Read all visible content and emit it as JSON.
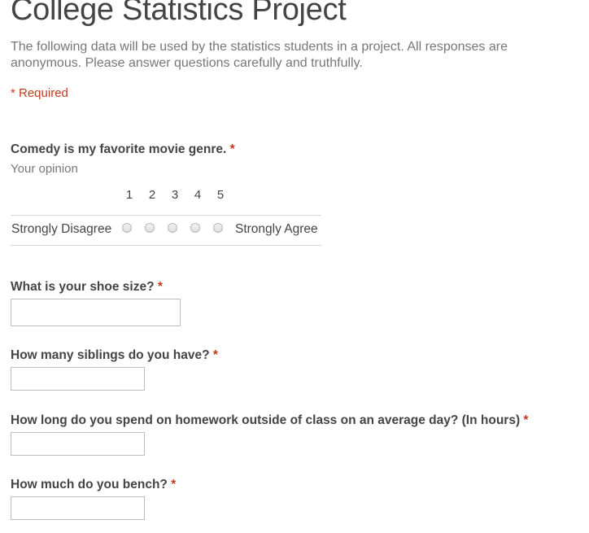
{
  "form": {
    "title": "College Statistics Project",
    "description": "The following data will be used by the statistics students in a project. All responses are anonymous. Please answer questions carefully and truthfully.",
    "required_note": "* Required",
    "required_marker": "*",
    "accent_color": "#c43b1d"
  },
  "questions": [
    {
      "type": "scale",
      "title": "Comedy is my favorite movie genre.",
      "help_text": "Your opinion",
      "scale_numbers": [
        "1",
        "2",
        "3",
        "4",
        "5"
      ],
      "low_label": "Strongly Disagree",
      "high_label": "Strongly Agree",
      "selected": null
    },
    {
      "type": "text",
      "title": "What is your shoe size?",
      "value": "",
      "placeholder": ""
    },
    {
      "type": "text",
      "title": "How many siblings do you have?",
      "value": "",
      "placeholder": ""
    },
    {
      "type": "text",
      "title": "How long do you spend on homework outside of class on an average day? (In hours)",
      "value": "",
      "placeholder": ""
    },
    {
      "type": "text",
      "title": "How much do you bench?",
      "value": "",
      "placeholder": ""
    }
  ]
}
